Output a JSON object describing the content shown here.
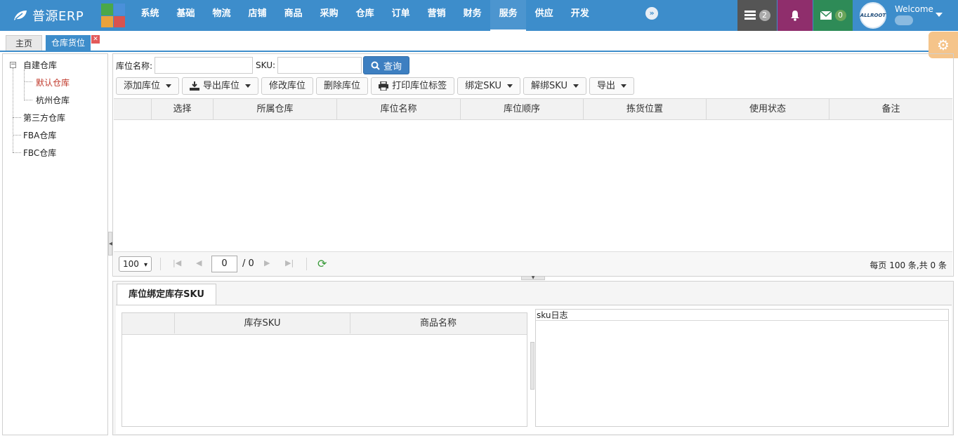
{
  "app": {
    "title": "普源ERP"
  },
  "nav": {
    "items": [
      "系统",
      "基础",
      "物流",
      "店铺",
      "商品",
      "采购",
      "仓库",
      "订单",
      "营销",
      "财务",
      "服务",
      "供应",
      "开发"
    ],
    "active": "服务",
    "more_glyph": "»"
  },
  "header_right": {
    "list_badge": "2",
    "mail_badge": "0",
    "welcome": "Welcome",
    "avatar_text": "ALLROOT"
  },
  "tabs": [
    {
      "label": "主页"
    },
    {
      "label": "仓库货位"
    }
  ],
  "tree": {
    "root": "自建仓库",
    "children": [
      "默认仓库",
      "杭州仓库"
    ],
    "selected": "默认仓库",
    "others": [
      "第三方仓库",
      "FBA仓库",
      "FBC仓库"
    ]
  },
  "search": {
    "location_label": "库位名称:",
    "location_value": "",
    "sku_label": "SKU:",
    "sku_value": "",
    "query_button": "查询"
  },
  "toolbar": {
    "add": "添加库位",
    "export_loc": "导出库位",
    "edit": "修改库位",
    "delete": "删除库位",
    "print": "打印库位标签",
    "bind": "绑定SKU",
    "unbind": "解绑SKU",
    "export": "导出"
  },
  "grid": {
    "columns": [
      "",
      "选择",
      "所属仓库",
      "库位名称",
      "库位顺序",
      "拣货位置",
      "使用状态",
      "备注"
    ]
  },
  "pager": {
    "page_size": "100",
    "current_page": "0",
    "total_pages": "/ 0",
    "info": "每页 100 条,共 0 条"
  },
  "bottom": {
    "tab_label": "库位绑定库存SKU",
    "sku_columns": [
      "",
      "库存SKU",
      "商品名称"
    ],
    "log_title": "sku日志"
  },
  "colors": {
    "header_bg": "#3d8dcb",
    "accent": "#3d7fc1",
    "selected_tree": "#c0392b"
  }
}
